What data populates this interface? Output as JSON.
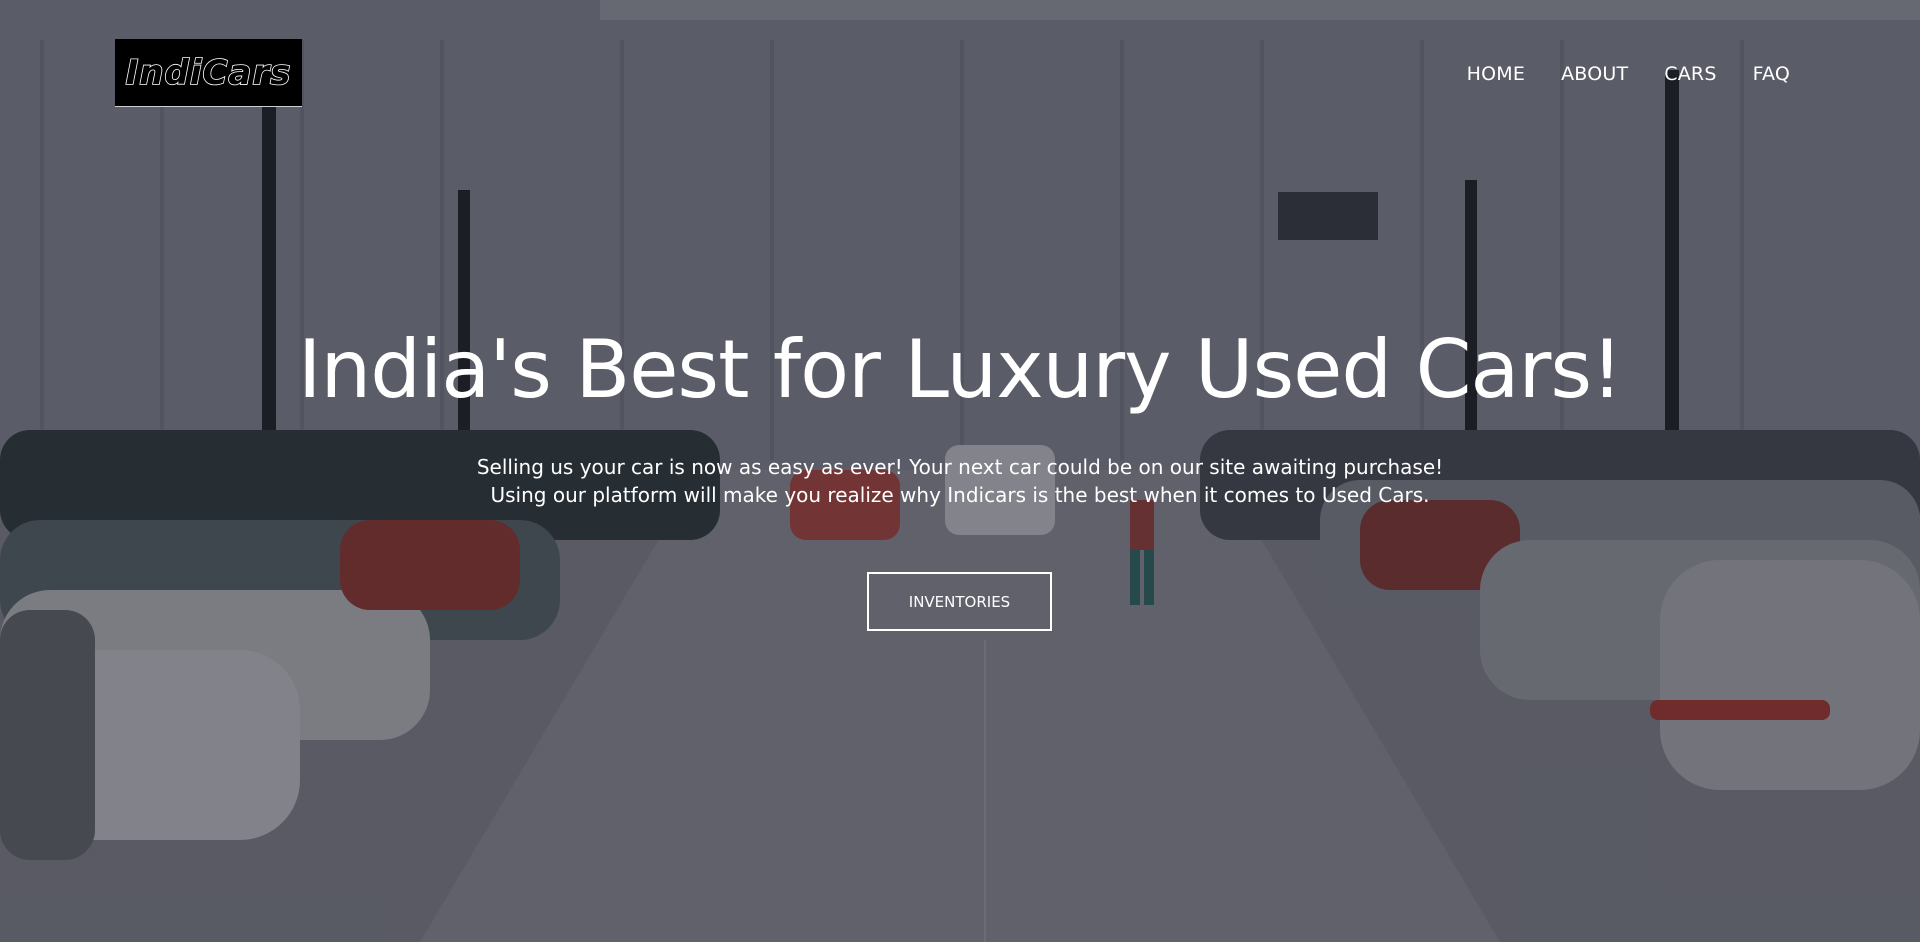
{
  "brand": {
    "logo_text": "IndiCars"
  },
  "nav": {
    "items": [
      {
        "label": "HOME"
      },
      {
        "label": "ABOUT"
      },
      {
        "label": "CARS"
      },
      {
        "label": "FAQ"
      }
    ]
  },
  "hero": {
    "headline": "India's Best for Luxury Used Cars!",
    "subline_1": "Selling us your car is now as easy as ever! Your next car could be on our site awaiting purchase!",
    "subline_2": "Using our platform will make you realize why Indicars is the best when it comes to Used Cars.",
    "cta_label": "INVENTORIES"
  },
  "colors": {
    "overlay": "#1c1c28",
    "text": "#ffffff",
    "logo_bg": "#000000"
  }
}
